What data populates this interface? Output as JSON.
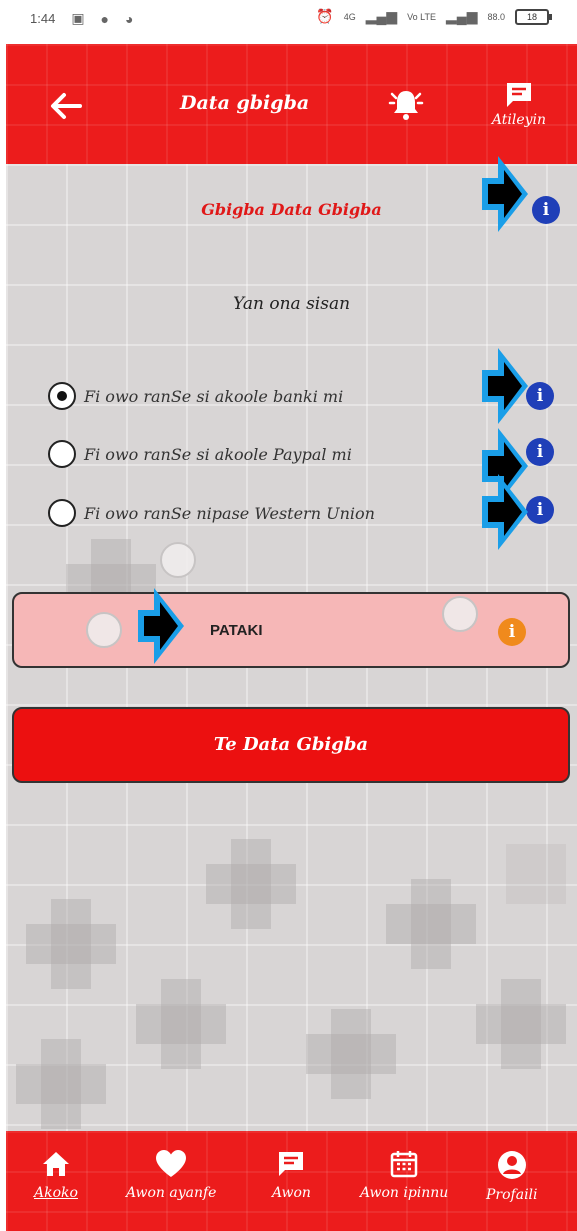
{
  "status_bar": {
    "time": "1:44",
    "network_4g": "4G",
    "volte": "Vo LTE",
    "speed": "88.0",
    "battery": "18"
  },
  "header": {
    "title": "Data gbigba",
    "feedback_label": "Atileyin"
  },
  "section": {
    "title": "Gbigba Data Gbigba",
    "subtitle": "Yan ona sisan"
  },
  "payment_options": [
    {
      "label": "Fi owo ranSe si akoole banki mi",
      "selected": true
    },
    {
      "label": "Fi owo ranSe si akoole Paypal mi",
      "selected": false
    },
    {
      "label": "Fi owo ranSe nipase Western Union",
      "selected": false
    }
  ],
  "important": {
    "label": "PATAKI"
  },
  "submit_button": {
    "label": "Te Data Gbigba"
  },
  "bottom_nav": [
    {
      "label": "Akoko",
      "icon": "home-icon",
      "active": true
    },
    {
      "label": "Awon ayanfe",
      "icon": "heart-icon",
      "active": false
    },
    {
      "label": "Awon",
      "icon": "chat-icon",
      "active": false
    },
    {
      "label": "Awon ipinnu",
      "icon": "calendar-icon",
      "active": false
    },
    {
      "label": "Profaili",
      "icon": "profile-icon",
      "active": false
    }
  ],
  "colors": {
    "primary_red": "#ec1c1c",
    "info_blue": "#1f3fb8",
    "info_orange": "#f08a1c",
    "important_box": "#f6b7b7",
    "arrow_marker": "#1a9ee8"
  }
}
